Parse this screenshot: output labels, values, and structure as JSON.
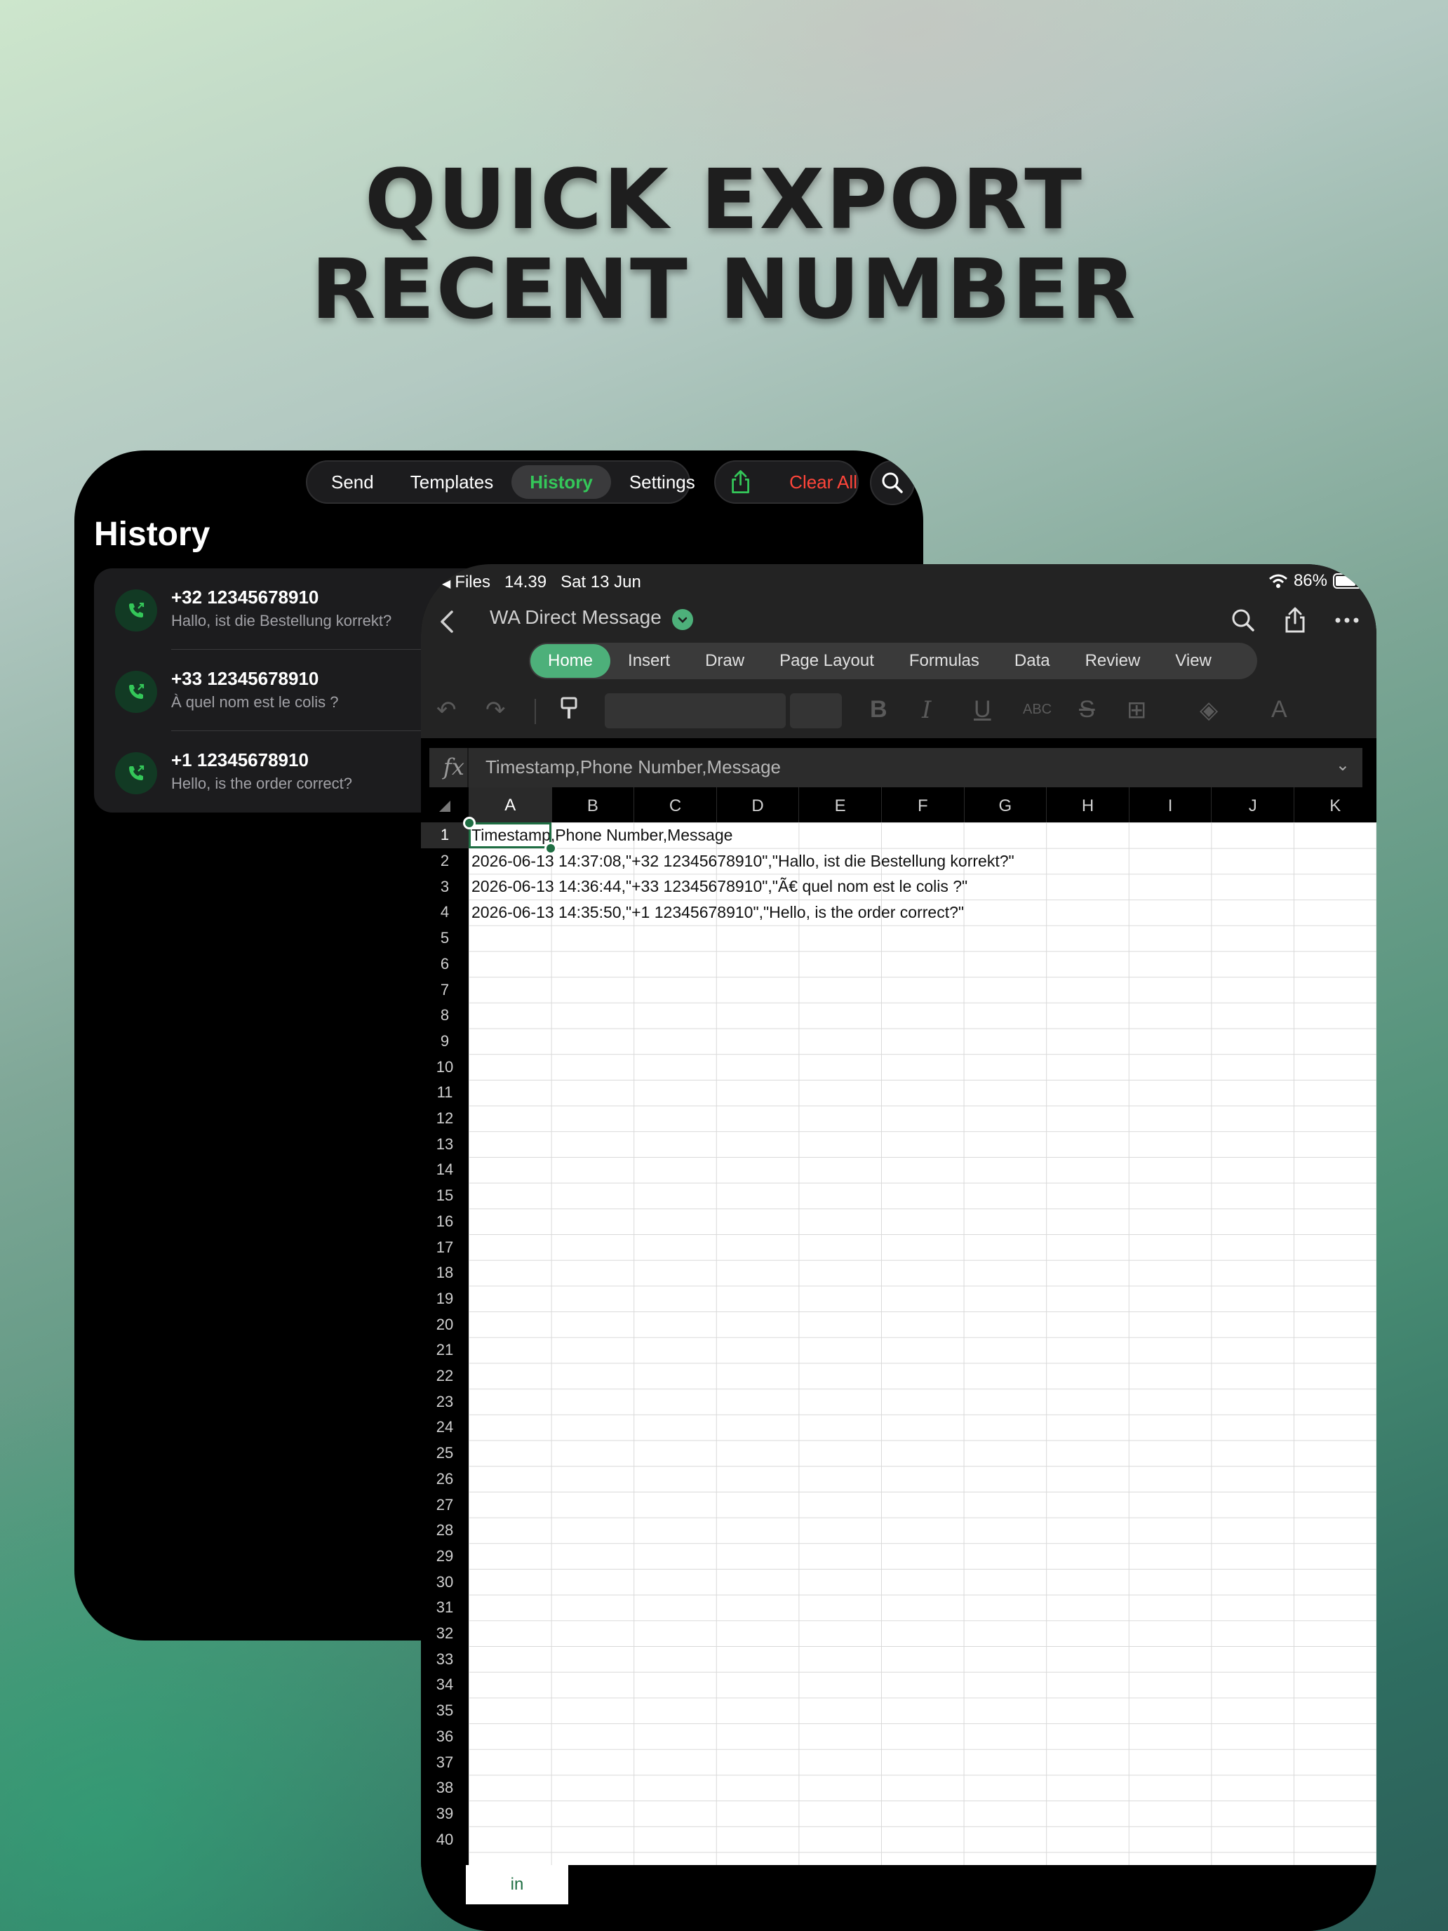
{
  "headline": {
    "line1": "QUICK EXPORT",
    "line2": "RECENT NUMBER"
  },
  "history_app": {
    "tabs": [
      "Send",
      "Templates",
      "History",
      "Settings"
    ],
    "active_tab": "History",
    "clear_all_label": "Clear All",
    "title": "History",
    "items": [
      {
        "number": "+32 12345678910",
        "message": "Hallo, ist die Bestellung korrekt?"
      },
      {
        "number": "+33 12345678910",
        "message": "À quel nom est le colis ?"
      },
      {
        "number": "+1 12345678910",
        "message": "Hello, is the order correct?"
      }
    ],
    "colors": {
      "accent": "#34c759",
      "danger": "#ff453a"
    }
  },
  "excel_app": {
    "status": {
      "back_app": "Files",
      "time": "14.39",
      "date": "Sat 13 Jun",
      "battery": "86%"
    },
    "document_title": "WA Direct Message",
    "ribbon_tabs": [
      "Home",
      "Insert",
      "Draw",
      "Page Layout",
      "Formulas",
      "Data",
      "Review",
      "View"
    ],
    "active_ribbon_tab": "Home",
    "formula_bar": {
      "fx_label": "fx",
      "content": "Timestamp,Phone Number,Message"
    },
    "columns": [
      "A",
      "B",
      "C",
      "D",
      "E",
      "F",
      "G",
      "H",
      "I",
      "J",
      "K"
    ],
    "selected_column": "A",
    "selected_cell": "A1",
    "row_count": 40,
    "rows": [
      "Timestamp,Phone Number,Message",
      "2026-06-13 14:37:08,\"+32 12345678910\",\"Hallo, ist die Bestellung korrekt?\"",
      "2026-06-13 14:36:44,\"+33 12345678910\",\"Ã€ quel nom est le colis ?\"",
      "2026-06-13 14:35:50,\"+1 12345678910\",\"Hello, is the order correct?\""
    ],
    "sheet_tab": "in",
    "colors": {
      "accent": "#4db07a",
      "selection": "#1f6e43"
    }
  }
}
